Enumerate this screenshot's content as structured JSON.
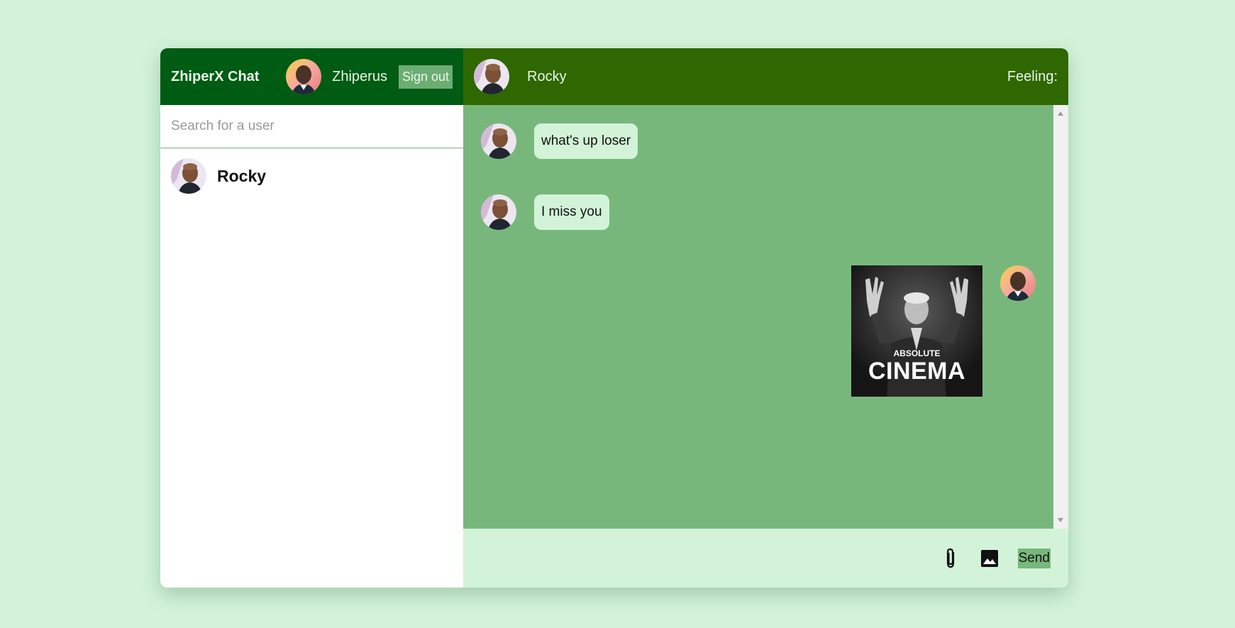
{
  "sidebar": {
    "brand": "ZhiperX Chat",
    "current_user": {
      "name": "Zhiperus",
      "avatar_icon": "user-avatar-icon"
    },
    "signout_label": "Sign out",
    "search": {
      "placeholder": "Search for a user",
      "value": ""
    },
    "users": [
      {
        "name": "Rocky",
        "avatar_icon": "contact-avatar-icon"
      }
    ]
  },
  "chat": {
    "contact_name": "Rocky",
    "feeling_label": "Feeling:",
    "messages": [
      {
        "from": "Rocky",
        "type": "text",
        "text": "what's up loser"
      },
      {
        "from": "Rocky",
        "type": "text",
        "text": "I miss you"
      },
      {
        "from": "Zhiperus",
        "type": "image",
        "caption_small": "ABSOLUTE",
        "caption_big": "CINEMA"
      }
    ],
    "composer": {
      "placeholder": "",
      "value": "",
      "attach_icon": "paperclip-icon",
      "image_icon": "image-icon",
      "send_label": "Send"
    }
  },
  "colors": {
    "page_bg": "#d2f3d8",
    "sidebar_header": "#005b13",
    "chat_header": "#2f6700",
    "messages_bg": "#78b77c",
    "bubble_bg": "#d2f3d8",
    "accent_button": "#78b77c"
  }
}
